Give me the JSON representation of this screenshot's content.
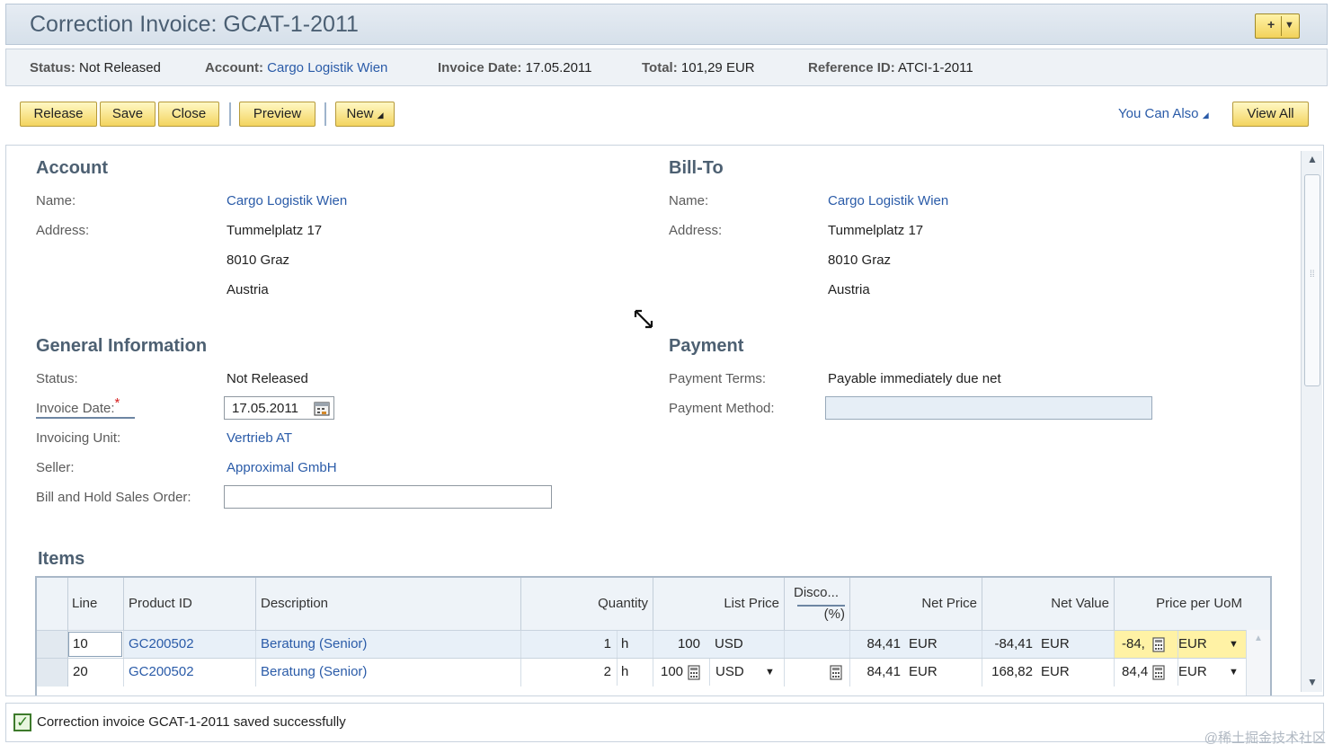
{
  "header": {
    "title": "Correction Invoice: GCAT-1-2011"
  },
  "statusbar": {
    "status_label": "Status:",
    "status_value": "Not Released",
    "account_label": "Account:",
    "account_value": "Cargo Logistik Wien",
    "invoice_date_label": "Invoice Date:",
    "invoice_date_value": "17.05.2011",
    "total_label": "Total:",
    "total_value": "101,29",
    "total_currency": "EUR",
    "reference_label": "Reference ID:",
    "reference_value": "ATCI-1-2011"
  },
  "toolbar": {
    "release": "Release",
    "save": "Save",
    "close": "Close",
    "preview": "Preview",
    "new": "New",
    "you_can_also": "You Can Also",
    "view_all": "View All"
  },
  "account": {
    "title": "Account",
    "name_label": "Name:",
    "name_value": "Cargo Logistik Wien",
    "address_label": "Address:",
    "address_line1": "Tummelplatz 17",
    "address_line2": "8010 Graz",
    "address_line3": "Austria"
  },
  "billto": {
    "title": "Bill-To",
    "name_label": "Name:",
    "name_value": "Cargo Logistik Wien",
    "address_label": "Address:",
    "address_line1": "Tummelplatz 17",
    "address_line2": "8010 Graz",
    "address_line3": "Austria"
  },
  "general": {
    "title": "General Information",
    "status_label": "Status:",
    "status_value": "Not Released",
    "invoice_date_label": "Invoice Date:",
    "required_marker": "*",
    "invoice_date_value": "17.05.2011",
    "invoicing_unit_label": "Invoicing Unit:",
    "invoicing_unit_value": "Vertrieb AT",
    "seller_label": "Seller:",
    "seller_value": "Approximal GmbH",
    "bill_hold_label": "Bill and Hold Sales Order:",
    "bill_hold_value": ""
  },
  "payment": {
    "title": "Payment",
    "terms_label": "Payment Terms:",
    "terms_value": "Payable immediately due net",
    "method_label": "Payment Method:",
    "method_value": ""
  },
  "items": {
    "title": "Items",
    "headers": {
      "line": "Line",
      "product_id": "Product ID",
      "description": "Description",
      "quantity": "Quantity",
      "list_price": "List Price",
      "discount_top": "Disco...",
      "discount_bottom": "(%)",
      "net_price": "Net Price",
      "net_value": "Net Value",
      "price_per_uom": "Price per UoM"
    },
    "rows": [
      {
        "line": "10",
        "product_id": "GC200502",
        "description": "Beratung (Senior)",
        "quantity": "1",
        "quantity_unit": "h",
        "list_price": "100",
        "list_currency": "USD",
        "discount": "",
        "net_price": "84,41",
        "net_price_currency": "EUR",
        "net_value": "-84,41",
        "net_value_currency": "EUR",
        "price_per_uom": "-84,",
        "price_per_uom_currency": "EUR"
      },
      {
        "line": "20",
        "product_id": "GC200502",
        "description": "Beratung (Senior)",
        "quantity": "2",
        "quantity_unit": "h",
        "list_price": "100",
        "list_currency": "USD",
        "discount": "",
        "net_price": "84,41",
        "net_price_currency": "EUR",
        "net_value": "168,82",
        "net_value_currency": "EUR",
        "price_per_uom": "84,4",
        "price_per_uom_currency": "EUR"
      }
    ]
  },
  "message": {
    "text": "Correction invoice GCAT-1-2011 saved successfully"
  },
  "watermark": "@稀土掘金技术社区",
  "icons": [
    "note-add-icon",
    "calendar-icon",
    "calculator-icon",
    "resize-cursor-icon",
    "success-check-icon",
    "dropdown-arrow-icon",
    "scroll-up-icon",
    "scroll-down-icon"
  ]
}
